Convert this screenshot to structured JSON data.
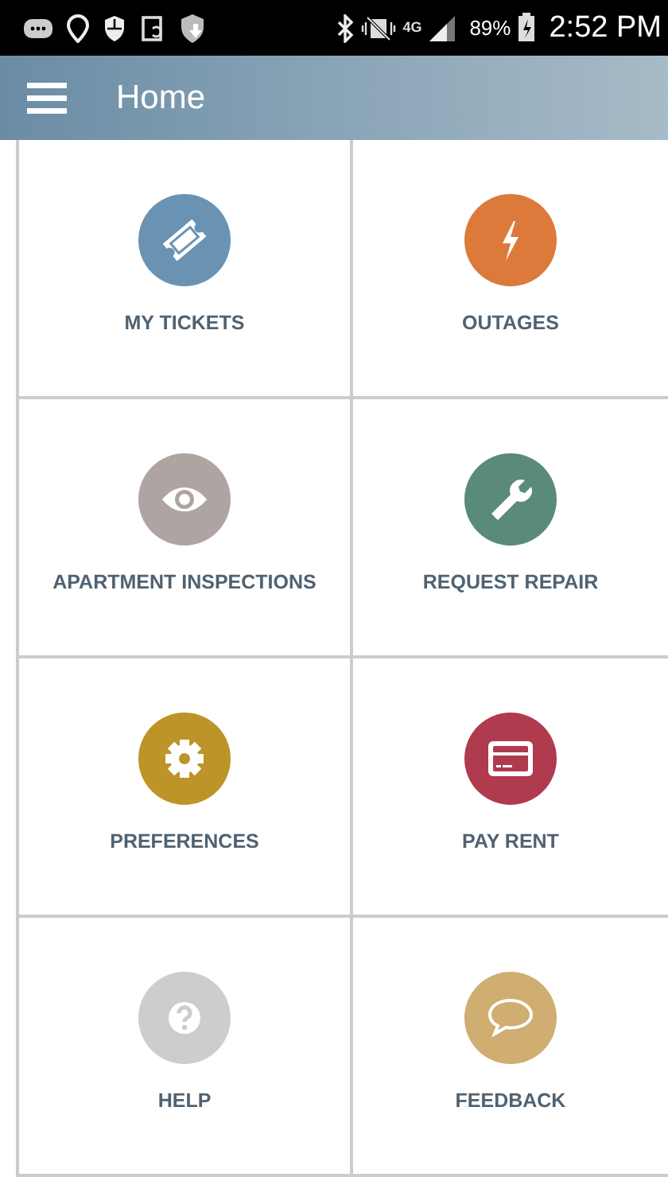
{
  "status_bar": {
    "network": "4G",
    "battery": "89%",
    "time": "2:52 PM"
  },
  "app_bar": {
    "title": "Home"
  },
  "tiles": [
    {
      "label": "MY TICKETS",
      "kind": "ticket",
      "color": "#6a93b3"
    },
    {
      "label": "OUTAGES",
      "kind": "bolt",
      "color": "#db7a3b"
    },
    {
      "label": "APARTMENT INSPECTIONS",
      "kind": "eye",
      "color": "#aea5a3"
    },
    {
      "label": "REQUEST REPAIR",
      "kind": "wrench",
      "color": "#5a8b78"
    },
    {
      "label": "PREFERENCES",
      "kind": "gear",
      "color": "#bd9428"
    },
    {
      "label": "PAY RENT",
      "kind": "card",
      "color": "#b03a4e"
    },
    {
      "label": "HELP",
      "kind": "question",
      "color": "#cfcdcb"
    },
    {
      "label": "FEEDBACK",
      "kind": "chat",
      "color": "#d0ad70"
    }
  ]
}
